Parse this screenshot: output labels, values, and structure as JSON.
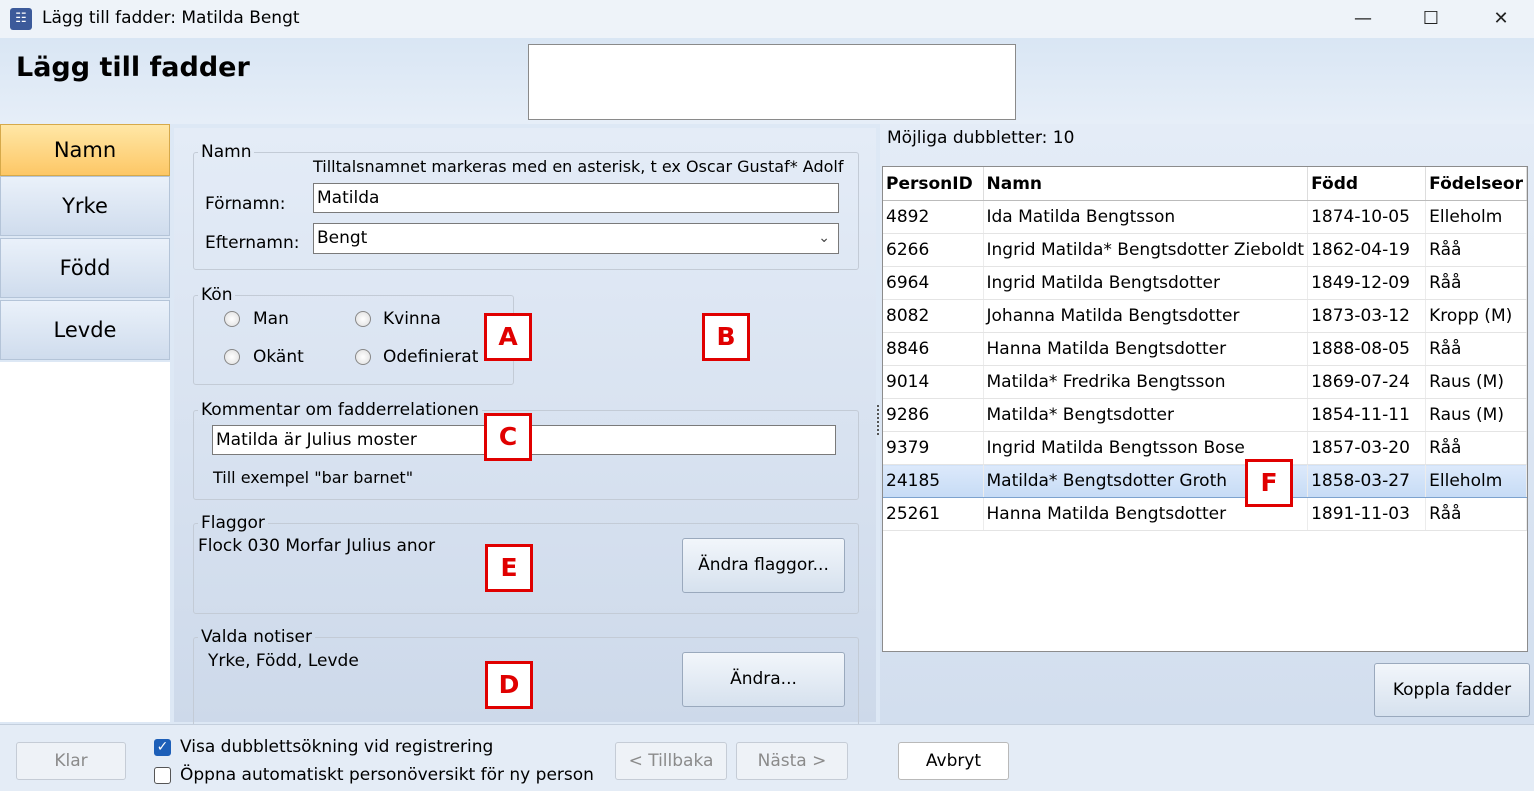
{
  "window": {
    "title": "Lägg till fadder: Matilda Bengt",
    "minimize_glyph": "—",
    "maximize_glyph": "☐",
    "close_glyph": "✕"
  },
  "page_title": "Lägg till fadder",
  "nav": {
    "items": [
      {
        "label": "Namn",
        "active": true
      },
      {
        "label": "Yrke",
        "active": false
      },
      {
        "label": "Född",
        "active": false
      },
      {
        "label": "Levde",
        "active": false
      }
    ]
  },
  "name_group": {
    "legend": "Namn",
    "hint": "Tilltalsnamnet markeras med en asterisk, t ex  Oscar Gustaf* Adolf",
    "firstname_label": "Förnamn:",
    "firstname_value": "Matilda",
    "lastname_label": "Efternamn:",
    "lastname_value": "Bengt"
  },
  "gender_group": {
    "legend": "Kön",
    "options": [
      "Man",
      "Kvinna",
      "Okänt",
      "Odefinierat"
    ]
  },
  "comment_group": {
    "legend": "Kommentar om fadderrelationen",
    "value": "Matilda är Julius moster",
    "hint": "Till exempel \"bar barnet\""
  },
  "flags_group": {
    "legend": "Flaggor",
    "value": "Flock 030 Morfar Julius anor",
    "button": "Ändra flaggor..."
  },
  "notices_group": {
    "legend": "Valda notiser",
    "value": "Yrke, Född, Levde",
    "button": "Ändra..."
  },
  "markers": {
    "A": "A",
    "B": "B",
    "C": "C",
    "D": "D",
    "E": "E",
    "F": "F"
  },
  "duplicates": {
    "label": "Möjliga dubbletter: 10",
    "columns": [
      "PersonID",
      "Namn",
      "Född",
      "Födelseor"
    ],
    "rows": [
      {
        "id": "4892",
        "name": "Ida Matilda Bengtsson",
        "born": "1874-10-05",
        "place": "Elleholm"
      },
      {
        "id": "6266",
        "name": "Ingrid Matilda* Bengtsdotter Zieboldt",
        "born": "1862-04-19",
        "place": "Råå"
      },
      {
        "id": "6964",
        "name": "Ingrid Matilda Bengtsdotter",
        "born": "1849-12-09",
        "place": "Råå"
      },
      {
        "id": "8082",
        "name": "Johanna Matilda Bengtsdotter",
        "born": "1873-03-12",
        "place": "Kropp (M)"
      },
      {
        "id": "8846",
        "name": "Hanna Matilda Bengtsdotter",
        "born": "1888-08-05",
        "place": "Råå"
      },
      {
        "id": "9014",
        "name": "Matilda* Fredrika Bengtsson",
        "born": "1869-07-24",
        "place": "Raus (M)"
      },
      {
        "id": "9286",
        "name": "Matilda* Bengtsdotter",
        "born": "1854-11-11",
        "place": "Raus (M)"
      },
      {
        "id": "9379",
        "name": "Ingrid Matilda Bengtsson Bose",
        "born": "1857-03-20",
        "place": "Råå"
      },
      {
        "id": "24185",
        "name": "Matilda* Bengtsdotter Groth",
        "born": "1858-03-27",
        "place": "Elleholm",
        "selected": true
      },
      {
        "id": "25261",
        "name": "Hanna Matilda Bengtsdotter",
        "born": "1891-11-03",
        "place": "Råå"
      }
    ],
    "link_button": "Koppla fadder"
  },
  "bottom": {
    "done": "Klar",
    "show_dup_search": "Visa dubblettsökning vid registrering",
    "show_dup_search_checked": true,
    "open_overview": "Öppna automatiskt personöversikt för ny person",
    "open_overview_checked": false,
    "back": "< Tillbaka",
    "next": "Nästa >",
    "cancel": "Avbryt"
  }
}
